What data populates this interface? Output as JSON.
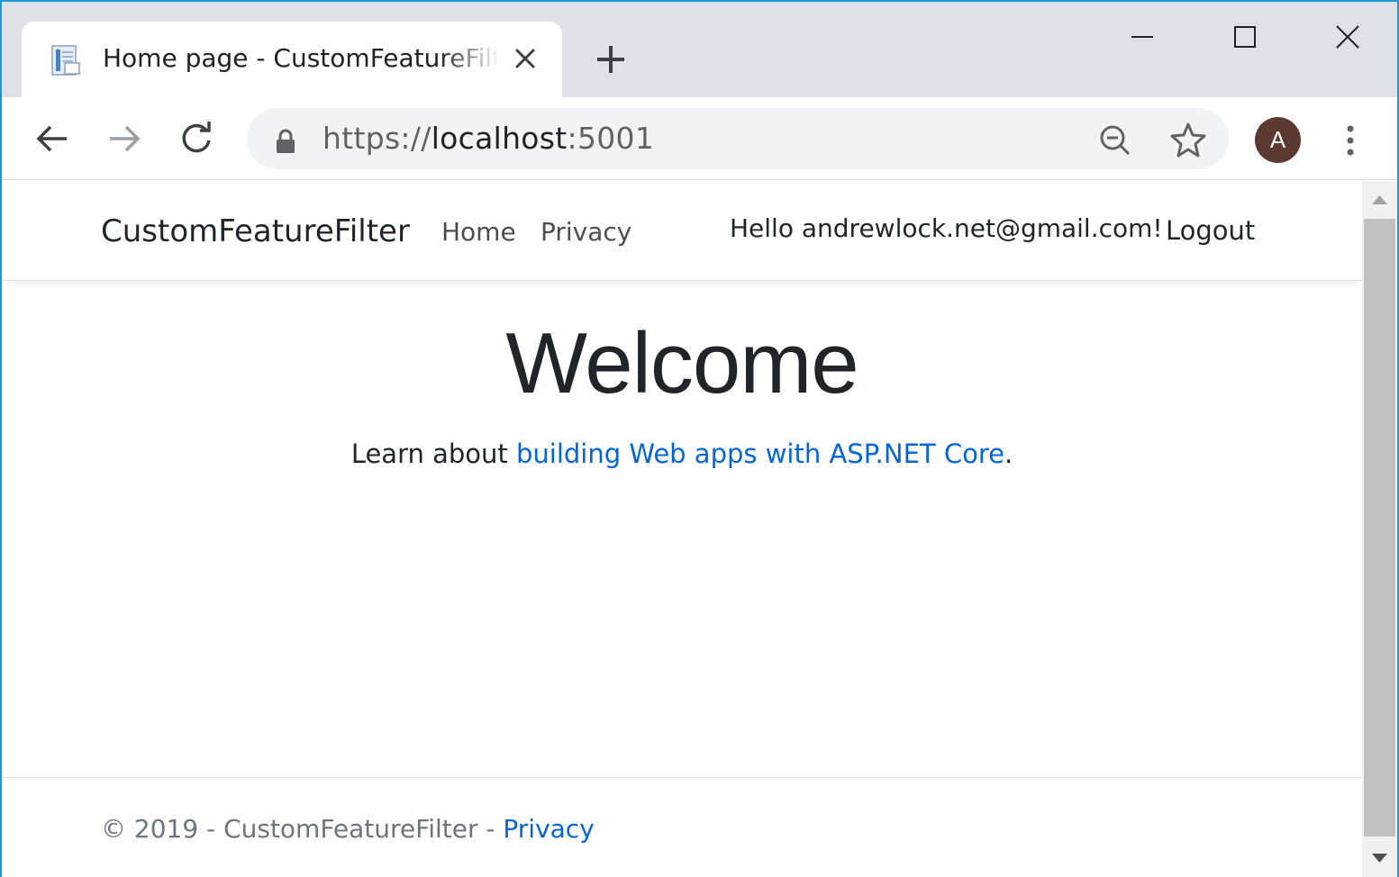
{
  "browser": {
    "tab": {
      "title": "Home page - CustomFeatureFilter",
      "favicon": "document-icon"
    },
    "address_bar": {
      "scheme": "https://",
      "host": "localhost",
      "port": ":5001"
    },
    "profile_initial": "A",
    "colors": {
      "tabstrip": "#dee1e6",
      "omnibox": "#f1f3f4",
      "avatar": "#5d3a31",
      "window_border": "#1a9ad6"
    }
  },
  "page": {
    "navbar": {
      "brand": "CustomFeatureFilter",
      "links": [
        "Home",
        "Privacy"
      ],
      "greeting": "Hello andrewlock.net@gmail.com!",
      "logout": "Logout"
    },
    "main": {
      "heading": "Welcome",
      "learn_prefix": "Learn about ",
      "learn_link": "building Web apps with ASP.NET Core",
      "learn_suffix": "."
    },
    "footer": {
      "copyright": "© 2019 - CustomFeatureFilter - ",
      "privacy_link": "Privacy"
    },
    "colors": {
      "link": "#0366d6",
      "text": "#212529",
      "muted": "#6c757d"
    }
  }
}
